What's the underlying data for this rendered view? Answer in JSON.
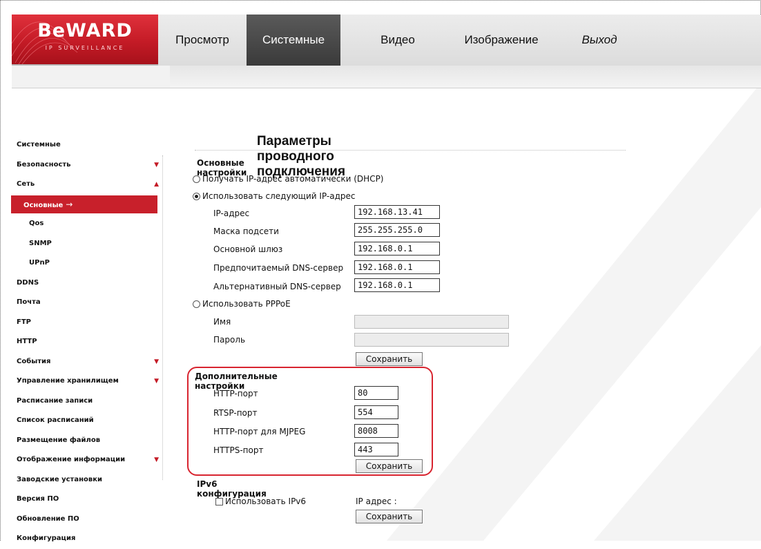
{
  "logo": {
    "brand": "BeWARD",
    "sub": "IP SURVEILLANCE"
  },
  "topnav": {
    "tabs": [
      {
        "label": "Просмотр",
        "active": false
      },
      {
        "label": "Системные",
        "active": true
      },
      {
        "label": "Видео",
        "active": false
      },
      {
        "label": "Изображение",
        "active": false
      },
      {
        "label": "Выход",
        "active": false
      }
    ]
  },
  "sidebar": {
    "items": [
      {
        "label": "Системные"
      },
      {
        "label": "Безопасность",
        "arrow": "▼"
      },
      {
        "label": "Сеть",
        "arrow": "▲"
      },
      {
        "label": "Основные",
        "active": true,
        "arrow_right": "→"
      },
      {
        "label": "Qos"
      },
      {
        "label": "SNMP"
      },
      {
        "label": "UPnP"
      },
      {
        "label": "DDNS"
      },
      {
        "label": "Почта"
      },
      {
        "label": "FTP"
      },
      {
        "label": "HTTP"
      },
      {
        "label": "События",
        "arrow": "▼"
      },
      {
        "label": "Управление хранилищем",
        "arrow": "▼"
      },
      {
        "label": "Расписание записи"
      },
      {
        "label": "Список расписаний"
      },
      {
        "label": "Размещение файлов"
      },
      {
        "label": "Отображение информации",
        "arrow": "▼"
      },
      {
        "label": "Заводские установки"
      },
      {
        "label": "Версия ПО"
      },
      {
        "label": "Обновление ПО"
      },
      {
        "label": "Конфигурация"
      }
    ]
  },
  "main": {
    "page_title": "Параметры проводного подключения",
    "basic": {
      "title": "Основные настройки",
      "dhcp_label": "Получать IP-адрес автоматически (DHCP)",
      "static_label": "Использовать следующий IP-адрес",
      "fields": {
        "ip_label": "IP-адрес",
        "ip_value": "192.168.13.41",
        "mask_label": "Маска подсети",
        "mask_value": "255.255.255.0",
        "gateway_label": "Основной шлюз",
        "gateway_value": "192.168.0.1",
        "dns1_label": "Предпочитаемый DNS-сервер",
        "dns1_value": "192.168.0.1",
        "dns2_label": "Альтернативный DNS-сервер",
        "dns2_value": "192.168.0.1"
      },
      "pppoe_label": "Использовать PPPoE",
      "pppoe_name_label": "Имя",
      "pppoe_password_label": "Пароль",
      "save_label": "Сохранить"
    },
    "advanced": {
      "title": "Дополнительные настройки",
      "http_port_label": "HTTP-порт",
      "http_port_value": "80",
      "rtsp_port_label": "RTSP-порт",
      "rtsp_port_value": "554",
      "mjpeg_port_label": "HTTP-порт для MJPEG",
      "mjpeg_port_value": "8008",
      "https_port_label": "HTTPS-порт",
      "https_port_value": "443",
      "save_label": "Сохранить"
    },
    "ipv6": {
      "title": "IPv6 конфигурация",
      "use_label": "Использовать IPv6",
      "ip_label": "IP адрес :",
      "save_label": "Сохранить"
    }
  },
  "colors": {
    "brand_red": "#c8202b",
    "active_tab": "#3a3a3a",
    "highlight": "#d8242f"
  }
}
